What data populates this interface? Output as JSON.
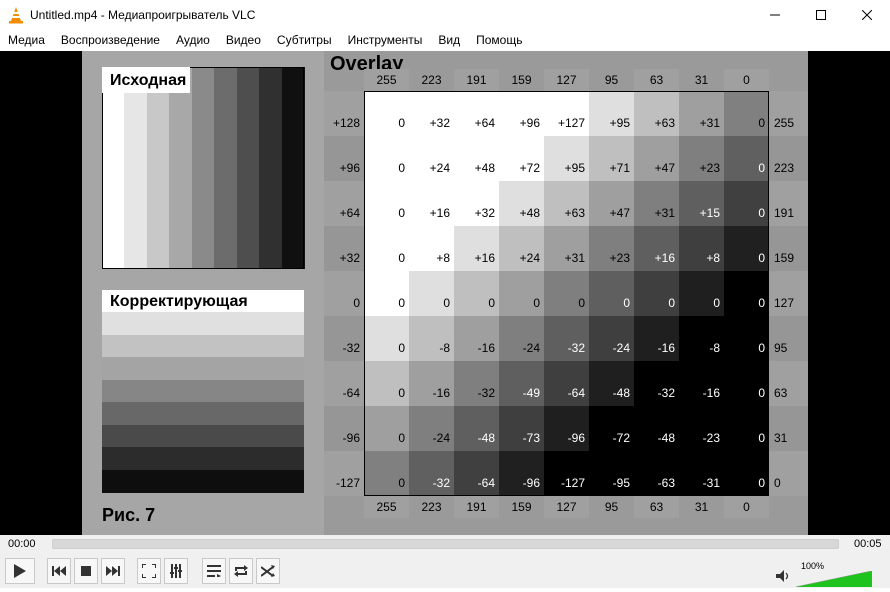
{
  "window": {
    "title": "Untitled.mp4 - Медиапроигрыватель VLC",
    "icon": "vlc-cone-icon",
    "controls": [
      "minimize-icon",
      "maximize-icon",
      "close-icon"
    ]
  },
  "menu": [
    "Медиа",
    "Воспроизведение",
    "Аудио",
    "Видео",
    "Субтитры",
    "Инструменты",
    "Вид",
    "Помощь"
  ],
  "video": {
    "source_label": "Исходная",
    "corrected_label": "Корректирующая",
    "overlay_title": "Overlay",
    "figure_label": "Рис. 7",
    "column_headers": [
      "255",
      "223",
      "191",
      "159",
      "127",
      "95",
      "63",
      "31",
      "0"
    ],
    "row_headers": [
      "+128",
      "+96",
      "+64",
      "+32",
      "0",
      "-32",
      "-64",
      "-96",
      "-127"
    ],
    "right_headers": [
      "255",
      "223",
      "191",
      "159",
      "127",
      "95",
      "63",
      "31",
      "0"
    ],
    "grid": [
      [
        "0",
        "+32",
        "+64",
        "+96",
        "+127",
        "+95",
        "+63",
        "+31",
        "0"
      ],
      [
        "0",
        "+24",
        "+48",
        "+72",
        "+95",
        "+71",
        "+47",
        "+23",
        "0"
      ],
      [
        "0",
        "+16",
        "+32",
        "+48",
        "+63",
        "+47",
        "+31",
        "+15",
        "0"
      ],
      [
        "0",
        "+8",
        "+16",
        "+24",
        "+31",
        "+23",
        "+16",
        "+8",
        "0"
      ],
      [
        "0",
        "0",
        "0",
        "0",
        "0",
        "0",
        "0",
        "0",
        "0"
      ],
      [
        "0",
        "-8",
        "-16",
        "-24",
        "-32",
        "-24",
        "-16",
        "-8",
        "0"
      ],
      [
        "0",
        "-16",
        "-32",
        "-49",
        "-64",
        "-48",
        "-32",
        "-16",
        "0"
      ],
      [
        "0",
        "-24",
        "-48",
        "-73",
        "-96",
        "-72",
        "-48",
        "-23",
        "0"
      ],
      [
        "0",
        "-32",
        "-64",
        "-96",
        "-127",
        "-95",
        "-63",
        "-31",
        "0"
      ]
    ],
    "source_bar_colors": [
      "#ffffff",
      "#e6e6e6",
      "#c8c8c8",
      "#a8a8a8",
      "#8a8a8a",
      "#6c6c6c",
      "#4e4e4e",
      "#303030",
      "#101010"
    ],
    "corrected_bar_colors": [
      "#ffffff",
      "#e0e0e0",
      "#c2c2c2",
      "#a4a4a4",
      "#868686",
      "#686868",
      "#4a4a4a",
      "#2c2c2c",
      "#0e0e0e"
    ]
  },
  "player": {
    "time_current": "00:00",
    "time_total": "00:05",
    "progress": 0,
    "volume_label": "100%",
    "volume_level": 1.0,
    "buttons": [
      {
        "name": "play-button",
        "icon": "play-icon"
      },
      {
        "name": "previous-button",
        "icon": "previous-icon"
      },
      {
        "name": "stop-button",
        "icon": "stop-icon"
      },
      {
        "name": "next-button",
        "icon": "next-icon"
      },
      {
        "name": "fullscreen-button",
        "icon": "fullscreen-icon"
      },
      {
        "name": "extended-settings-button",
        "icon": "equalizer-icon"
      },
      {
        "name": "playlist-button",
        "icon": "playlist-icon"
      },
      {
        "name": "loop-button",
        "icon": "loop-icon"
      },
      {
        "name": "shuffle-button",
        "icon": "shuffle-icon"
      }
    ],
    "accent": "#1ec31e"
  }
}
